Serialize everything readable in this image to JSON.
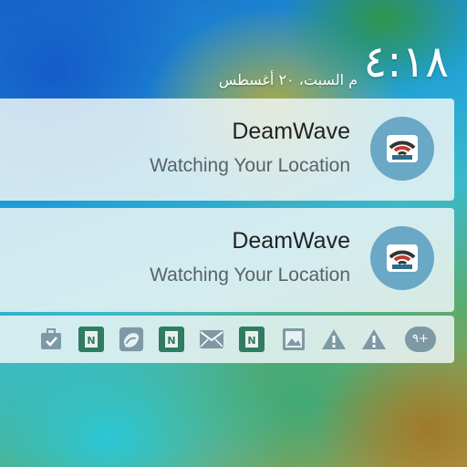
{
  "lockscreen": {
    "time": "٤:١٨",
    "date": "م  السبت، ٢٠ أغسطس"
  },
  "notifications": [
    {
      "app_name": "DeamWave",
      "message": "Watching Your Location",
      "icon": "deamwave-app-icon"
    },
    {
      "app_name": "DeamWave",
      "message": "Watching Your Location",
      "icon": "deamwave-app-icon"
    }
  ],
  "tray": {
    "icons": [
      "briefcase-check-icon",
      "n-app-icon",
      "sketch-app-icon",
      "n-app-icon",
      "mail-icon",
      "n-app-icon",
      "image-icon",
      "warning-icon",
      "warning-icon",
      "more-count-badge"
    ],
    "more_count": "٩+"
  },
  "colors": {
    "card_background": "#ECF4F6",
    "app_icon_circle": "#6AA8C5",
    "tray_icon": "#7E99A6",
    "n_app_green": "#2F7C62"
  }
}
